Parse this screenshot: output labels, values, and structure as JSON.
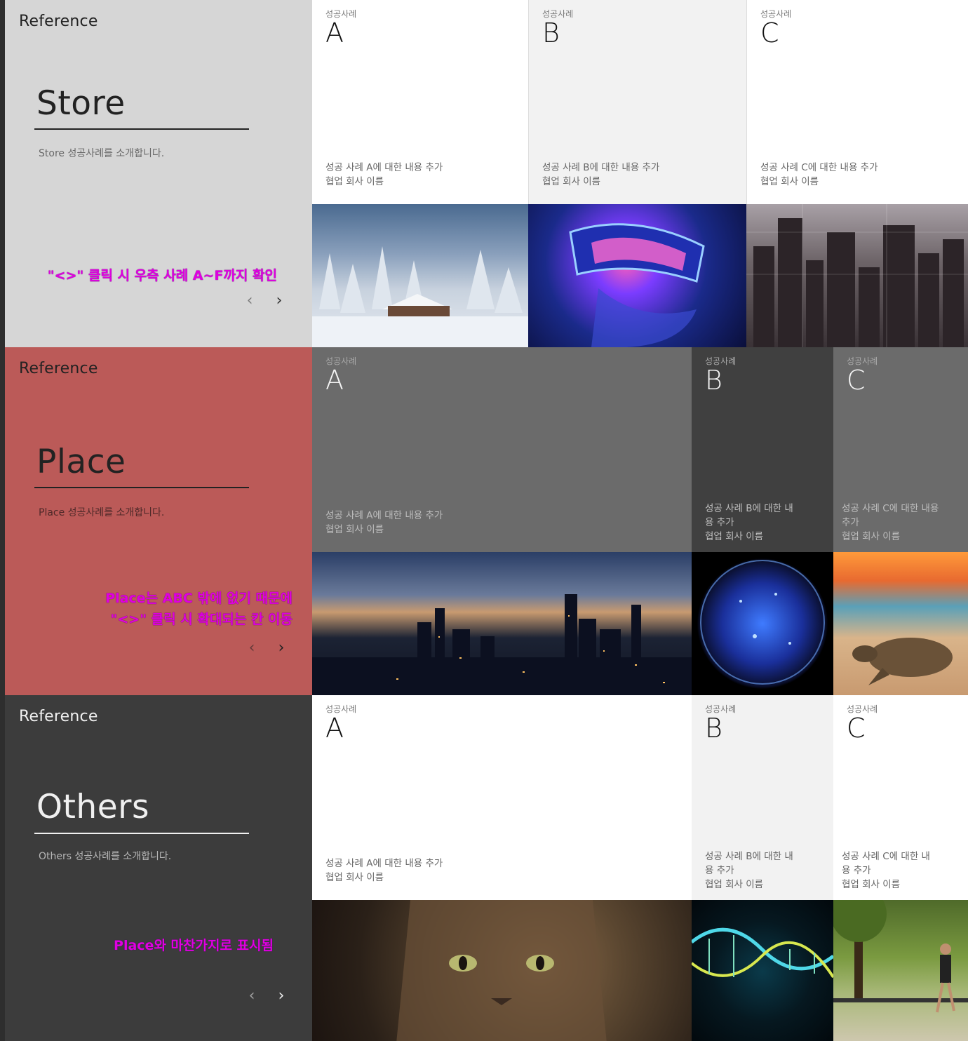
{
  "common": {
    "reference_label": "Reference",
    "case_label": "성공사례",
    "prev_glyph": "‹",
    "next_glyph": "›"
  },
  "sections": [
    {
      "title": "Store",
      "description": "Store 성공사례를 소개합니다.",
      "note": "\"<>\" 클릭 시 우측 사례 A~F까지 확인",
      "cards": [
        {
          "letter": "A",
          "body_line1": "성공 사례 A에 대한 내용 추가",
          "body_line2": "협업 회사 이름",
          "image": "snowy-cabin-image"
        },
        {
          "letter": "B",
          "body_line1": "성공 사례 B에 대한 내용 추가",
          "body_line2": "협업 회사 이름",
          "image": "vr-headset-image"
        },
        {
          "letter": "C",
          "body_line1": "성공 사례 C에 대한 내용 추가",
          "body_line2": "협업 회사 이름",
          "image": "city-skyline-image"
        }
      ]
    },
    {
      "title": "Place",
      "description": "Place 성공사례를 소개합니다.",
      "note_line1": "Place는 ABC 밖에 없기 때문에",
      "note_line2": "\"<>\" 클릭 시 확대되는 칸 이동",
      "cards": [
        {
          "letter": "A",
          "body_line1": "성공 사례 A에 대한 내용 추가",
          "body_line2": "협업 회사 이름",
          "image": "night-city-image"
        },
        {
          "letter": "B",
          "body_line1": "성공 사례 B에 대한 내",
          "body_line2": "용 추가",
          "body_line3": "협업 회사 이름",
          "image": "blue-planet-image"
        },
        {
          "letter": "C",
          "body_line1": "성공 사례 C에 대한 내용",
          "body_line2": "추가",
          "body_line3": "협업 회사 이름",
          "image": "sea-turtle-image"
        }
      ]
    },
    {
      "title": "Others",
      "description": "Others 성공사례를 소개합니다.",
      "note": "Place와 마찬가지로 표시됨",
      "cards": [
        {
          "letter": "A",
          "body_line1": "성공 사례 A에 대한 내용 추가",
          "body_line2": "협업 회사 이름",
          "image": "cat-image"
        },
        {
          "letter": "B",
          "body_line1": "성공 사례 B에 대한 내",
          "body_line2": "용 추가",
          "body_line3": "협업 회사 이름",
          "image": "dna-helix-image"
        },
        {
          "letter": "C",
          "body_line1": "성공 사례 C에 대한 내",
          "body_line2": "용 추가",
          "body_line3": "협업 회사 이름",
          "image": "park-runner-image"
        }
      ]
    }
  ],
  "colors": {
    "store_panel": "#d6d6d6",
    "place_panel": "#bb5a58",
    "others_panel": "#3c3c3c",
    "annotation": "#e000e0"
  }
}
